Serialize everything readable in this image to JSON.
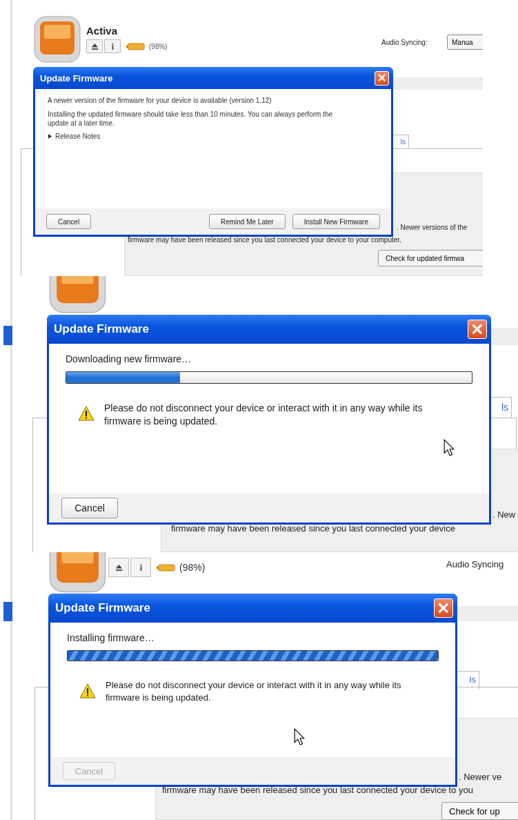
{
  "panels": [
    {
      "app": {
        "device_name": "Activa",
        "battery_text": "(98%)",
        "audio_syncing_label": "Audio Syncing:",
        "sync_button": "Manua",
        "tab_label": "ls",
        "notice_line_1": ". Newer versions of the",
        "notice_line_2": "firmware may have been released since you last connected your device to your computer.",
        "check_button": "Check for updated firmwa"
      },
      "dialog": {
        "title": "Update Firmware",
        "messages": [
          "A newer version of the firmware for your device is available (version 1.12)",
          "Installing the updated firmware should take less than 10 minutes. You can always perform the update at a later time."
        ],
        "expander": {
          "label": "Release Notes",
          "expanded": false
        },
        "buttons": [
          {
            "label": "Cancel",
            "disabled": false
          },
          {
            "label": "Remind Me Later",
            "disabled": false
          },
          {
            "label": "Install New Firmware",
            "disabled": false
          }
        ]
      }
    },
    {
      "app": {
        "tab_label": "ls",
        "notice_line_1": ". New",
        "notice_line_2": "firmware may have been released since you last connected your device"
      },
      "dialog": {
        "title": "Update Firmware",
        "status": "Downloading new firmware…",
        "progress": {
          "kind": "determinate",
          "level": 0.28
        },
        "warning": "Please do not disconnect your device or interact with it in any way while its firmware is being updated.",
        "buttons": [
          {
            "label": "Cancel",
            "disabled": false
          }
        ]
      }
    },
    {
      "app": {
        "battery_text": "(98%)",
        "audio_syncing_label": "Audio Syncing",
        "tab_label": "ls",
        "notice_line_1": ". Newer ve",
        "notice_line_2": "firmware may have been released since you last connected your device to you",
        "check_button": "Check for up"
      },
      "dialog": {
        "title": "Update Firmware",
        "status": "Installing firmware…",
        "progress": {
          "kind": "marquee",
          "level": 1
        },
        "warning": "Please do not disconnect your device or interact with it in any way while its firmware is being updated.",
        "buttons": [
          {
            "label": "Cancel",
            "disabled": true
          }
        ]
      }
    }
  ]
}
